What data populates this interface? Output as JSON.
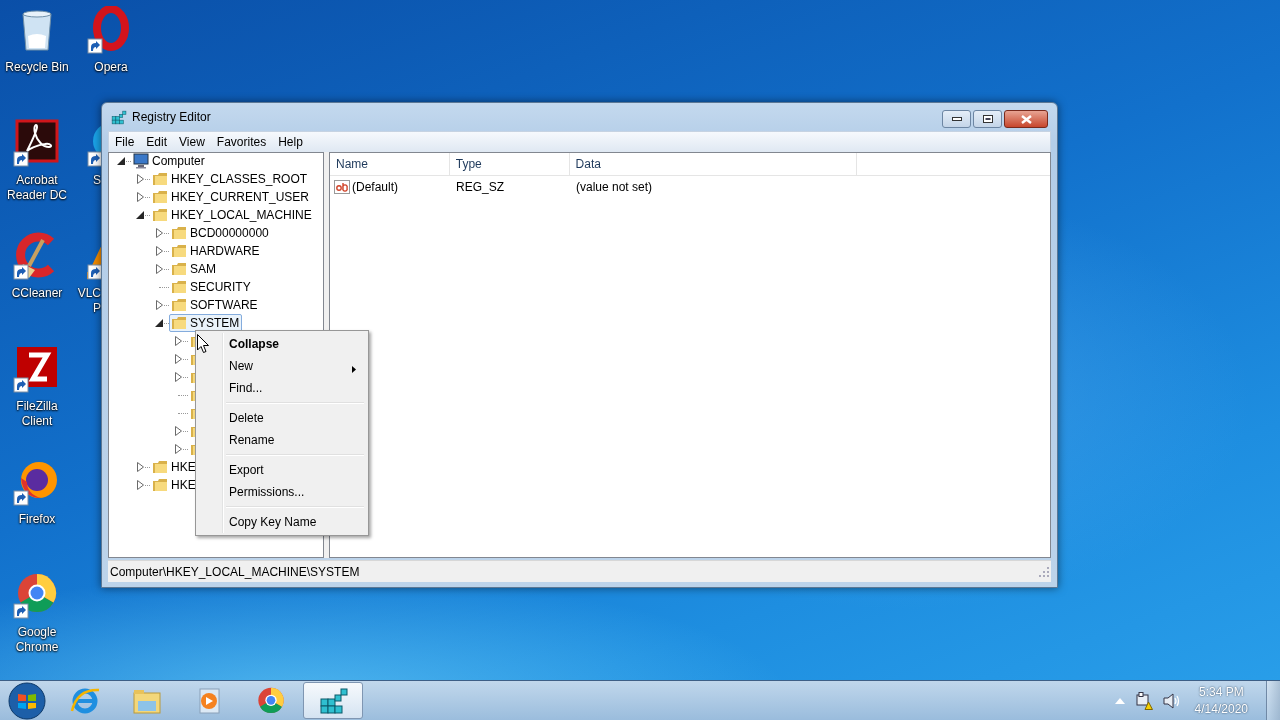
{
  "desktop": {
    "icon_columns": [
      [
        {
          "label": "Recycle Bin",
          "kind": "recycle",
          "shortcut": false
        },
        {
          "label": "Acrobat Reader DC",
          "kind": "acrobat",
          "shortcut": true
        },
        {
          "label": "CCleaner",
          "kind": "ccleaner",
          "shortcut": true
        },
        {
          "label": "FileZilla Client",
          "kind": "filezilla",
          "shortcut": true
        },
        {
          "label": "Firefox",
          "kind": "firefox",
          "shortcut": true
        },
        {
          "label": "Google Chrome",
          "kind": "chrome",
          "shortcut": true
        }
      ],
      [
        {
          "label": "Opera",
          "kind": "opera",
          "shortcut": true
        },
        {
          "label": "S",
          "kind": "skype",
          "shortcut": true,
          "clipped": true
        },
        {
          "label": "VLC\nP",
          "kind": "vlc",
          "shortcut": true,
          "clipped": true
        }
      ]
    ]
  },
  "window": {
    "title": "Registry Editor",
    "menu": [
      "File",
      "Edit",
      "View",
      "Favorites",
      "Help"
    ],
    "tree": [
      {
        "label": "Computer",
        "expandable": true,
        "expanded": true,
        "selected": false,
        "children": [
          {
            "label": "HKEY_CLASSES_ROOT",
            "expandable": true,
            "expanded": false,
            "selected": false
          },
          {
            "label": "HKEY_CURRENT_USER",
            "expandable": true,
            "expanded": false,
            "selected": false
          },
          {
            "label": "HKEY_LOCAL_MACHINE",
            "expandable": true,
            "expanded": true,
            "selected": false,
            "children": [
              {
                "label": "BCD00000000",
                "expandable": true,
                "expanded": false,
                "selected": false
              },
              {
                "label": "HARDWARE",
                "expandable": true,
                "expanded": false,
                "selected": false
              },
              {
                "label": "SAM",
                "expandable": true,
                "expanded": false,
                "selected": false
              },
              {
                "label": "SECURITY",
                "expandable": false,
                "selected": false
              },
              {
                "label": "SOFTWARE",
                "expandable": true,
                "expanded": false,
                "selected": false
              },
              {
                "label": "SYSTEM",
                "expandable": true,
                "expanded": true,
                "selected": true,
                "children": [
                  {
                    "expandable": true,
                    "expanded": false,
                    "selected": false
                  },
                  {
                    "expandable": true,
                    "expanded": false,
                    "selected": false
                  },
                  {
                    "expandable": true,
                    "expanded": false,
                    "selected": false
                  },
                  {
                    "expandable": false,
                    "selected": false
                  },
                  {
                    "expandable": false,
                    "selected": false
                  },
                  {
                    "expandable": true,
                    "expanded": false,
                    "selected": false
                  },
                  {
                    "expandable": true,
                    "expanded": false,
                    "selected": false
                  }
                ]
              }
            ]
          },
          {
            "label": "HKE",
            "expandable": true,
            "expanded": false,
            "selected": false
          },
          {
            "label": "HKE",
            "expandable": true,
            "expanded": false,
            "selected": false
          }
        ]
      }
    ],
    "list": {
      "columns": [
        "Name",
        "Type",
        "Data"
      ],
      "rows": [
        {
          "kind": "string",
          "name": "(Default)",
          "type": "REG_SZ",
          "data": "(value not set)"
        }
      ]
    },
    "status_bar": "Computer\\HKEY_LOCAL_MACHINE\\SYSTEM"
  },
  "context_menu": [
    {
      "kind": "item",
      "label": "Collapse",
      "default": true,
      "submenu": false
    },
    {
      "kind": "item",
      "label": "New",
      "default": false,
      "submenu": true
    },
    {
      "kind": "item",
      "label": "Find...",
      "default": false,
      "submenu": false
    },
    {
      "kind": "separator"
    },
    {
      "kind": "item",
      "label": "Delete",
      "default": false,
      "submenu": false
    },
    {
      "kind": "item",
      "label": "Rename",
      "default": false,
      "submenu": false
    },
    {
      "kind": "separator"
    },
    {
      "kind": "item",
      "label": "Export",
      "default": false,
      "submenu": false
    },
    {
      "kind": "item",
      "label": "Permissions...",
      "default": false,
      "submenu": false
    },
    {
      "kind": "separator"
    },
    {
      "kind": "item",
      "label": "Copy Key Name",
      "default": false,
      "submenu": false
    }
  ],
  "taskbar": {
    "items": [
      {
        "kind": "ie",
        "active": false
      },
      {
        "kind": "explorer",
        "active": false
      },
      {
        "kind": "mediaplayer",
        "active": false
      },
      {
        "kind": "chrome",
        "active": false
      },
      {
        "kind": "regedit",
        "active": true
      }
    ],
    "clock": {
      "time": "5:34 PM",
      "date": "4/14/2020"
    }
  }
}
